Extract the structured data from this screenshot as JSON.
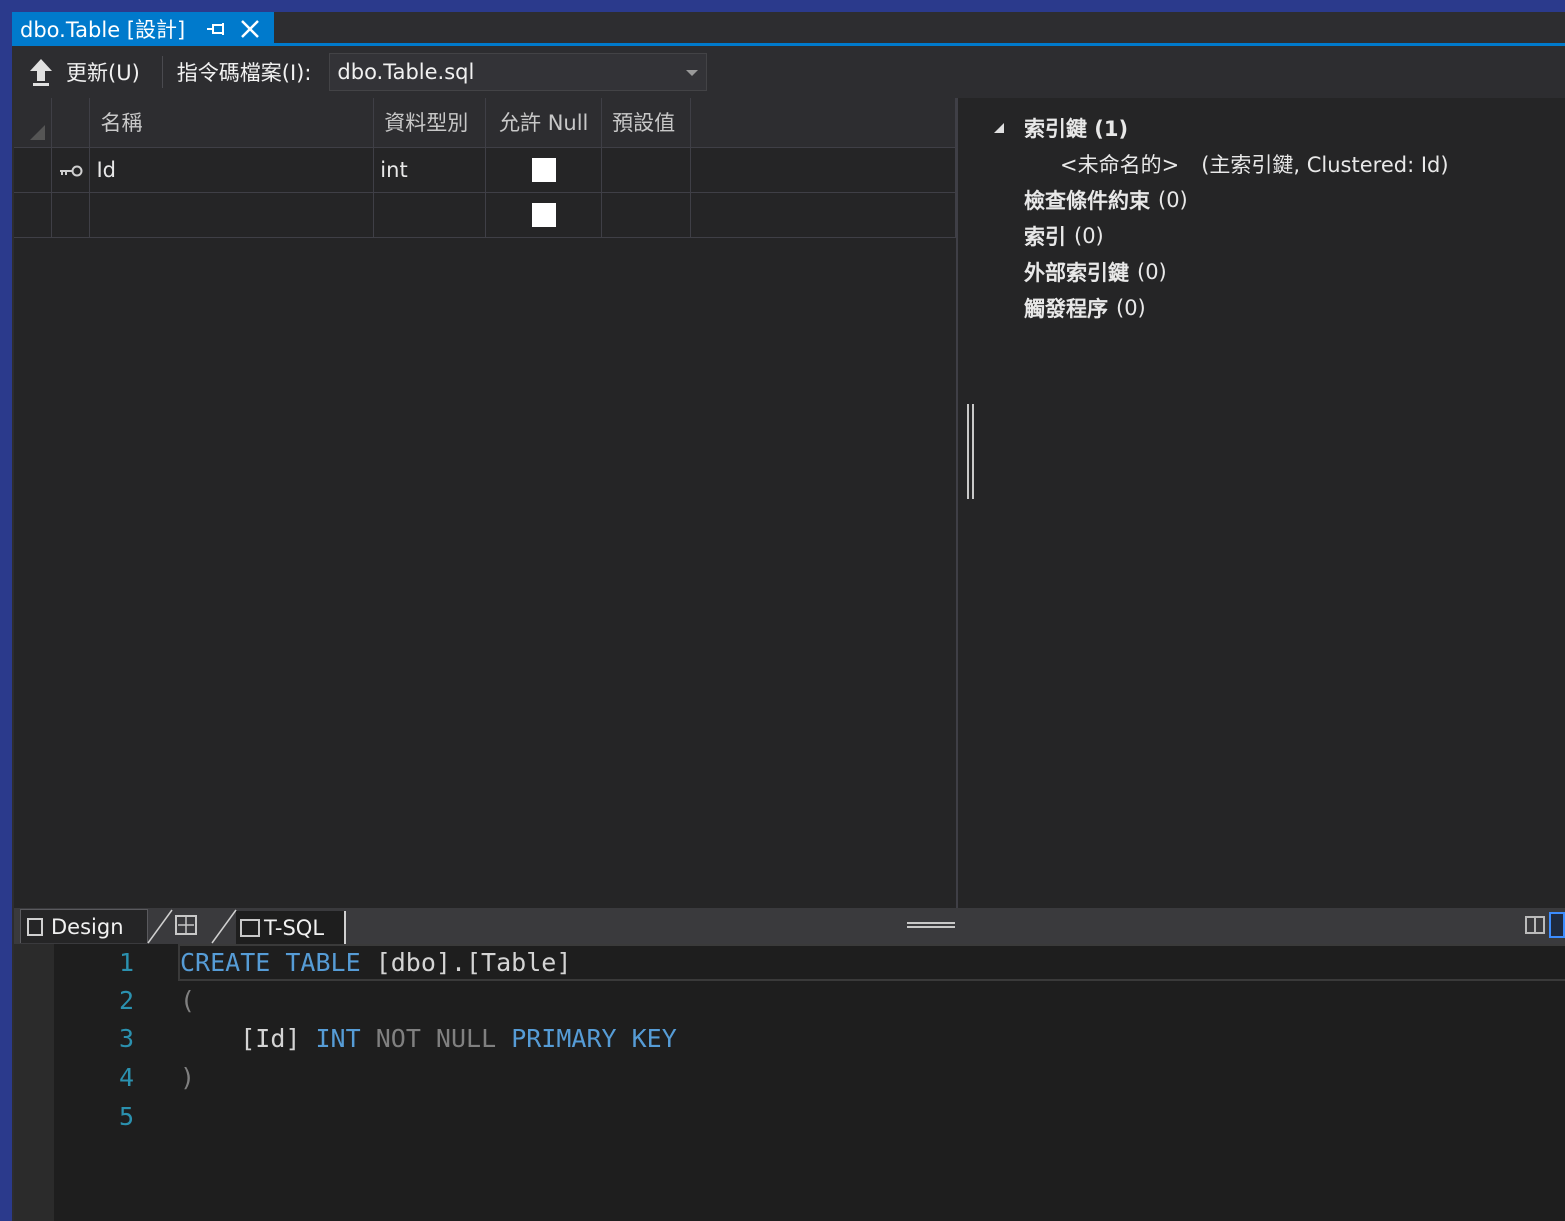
{
  "document_tab": {
    "title": "dbo.Table [設計]",
    "pin_icon": "pin-icon",
    "close_icon": "close-icon"
  },
  "toolbar": {
    "update_label": "更新(U)",
    "script_file_label": "指令碼檔案(I):",
    "script_file_value": "dbo.Table.sql"
  },
  "grid": {
    "columns": [
      "名稱",
      "資料型別",
      "允許 Null",
      "預設值"
    ],
    "rows": [
      {
        "name": "Id",
        "type": "int",
        "allow_null": false,
        "default": "",
        "is_primary_key": true
      },
      {
        "name": "",
        "type": "",
        "allow_null": false,
        "default": "",
        "is_primary_key": false
      }
    ]
  },
  "properties_tree": {
    "keys_label": "索引鍵 (1)",
    "key_item_name": "<未命名的>",
    "key_item_detail": "(主索引鍵, Clustered: Id)",
    "check_constraints": {
      "label": "檢查條件約束",
      "count": "(0)"
    },
    "indexes": {
      "label": "索引",
      "count": "(0)"
    },
    "foreign_keys": {
      "label": "外部索引鍵",
      "count": "(0)"
    },
    "triggers": {
      "label": "觸發程序",
      "count": "(0)"
    }
  },
  "bottom_tabs": {
    "design": "Design",
    "split_icon": "swap-panes-icon",
    "tsql": "T-SQL"
  },
  "editor": {
    "line_numbers": [
      "1",
      "2",
      "3",
      "4",
      "5"
    ],
    "lines": {
      "l1_kw1": "CREATE",
      "l1_kw2": "TABLE",
      "l1_rest": "[dbo].[Table]",
      "l2": "(",
      "l3_id": "[Id]",
      "l3_int": "INT",
      "l3_notnull": "NOT NULL",
      "l3_pk": "PRIMARY KEY",
      "l4": ")"
    }
  },
  "colors": {
    "accent": "#007acc",
    "frame": "#2b3a8c",
    "keyword": "#569cd6",
    "line_number": "#2b91af"
  }
}
